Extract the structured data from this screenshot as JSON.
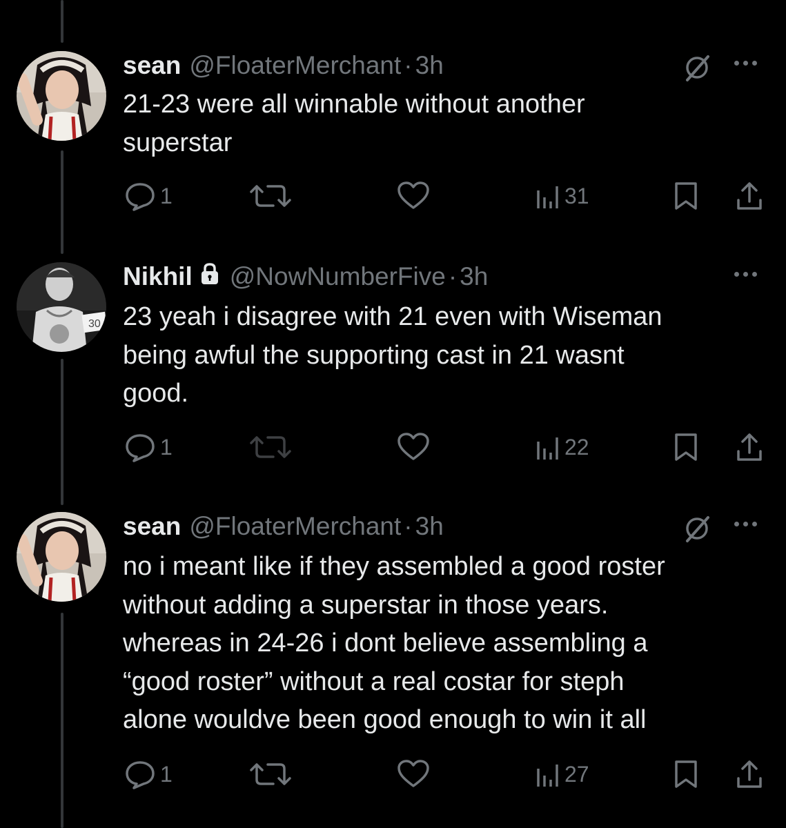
{
  "tweets": [
    {
      "name": "sean",
      "handle": "@FloaterMerchant",
      "sep": "·",
      "time": "3h",
      "text": "21-23 were all winnable without another\nsuperstar",
      "replies": "1",
      "views": "31",
      "locked": false,
      "grok": true
    },
    {
      "name": "Nikhil",
      "handle": "@NowNumberFive",
      "sep": "·",
      "time": "3h",
      "text": "23 yeah i disagree with 21 even with Wiseman\nbeing awful the supporting cast in 21 wasnt\ngood.",
      "replies": "1",
      "views": "22",
      "locked": true,
      "grok": false,
      "avatar_jersey_number": "30"
    },
    {
      "name": "sean",
      "handle": "@FloaterMerchant",
      "sep": "·",
      "time": "3h",
      "text": "no i meant like if they assembled a good roster\nwithout adding a superstar in those years.\nwhereas in 24-26 i dont believe assembling a\n“good roster” without a real costar for steph\nalone wouldve been good enough to win it all",
      "replies": "1",
      "views": "27",
      "locked": false,
      "grok": true
    }
  ],
  "colors": {
    "background": "#000000",
    "text": "#e7e9ea",
    "secondary": "#71767b",
    "thread_line": "#333639"
  }
}
